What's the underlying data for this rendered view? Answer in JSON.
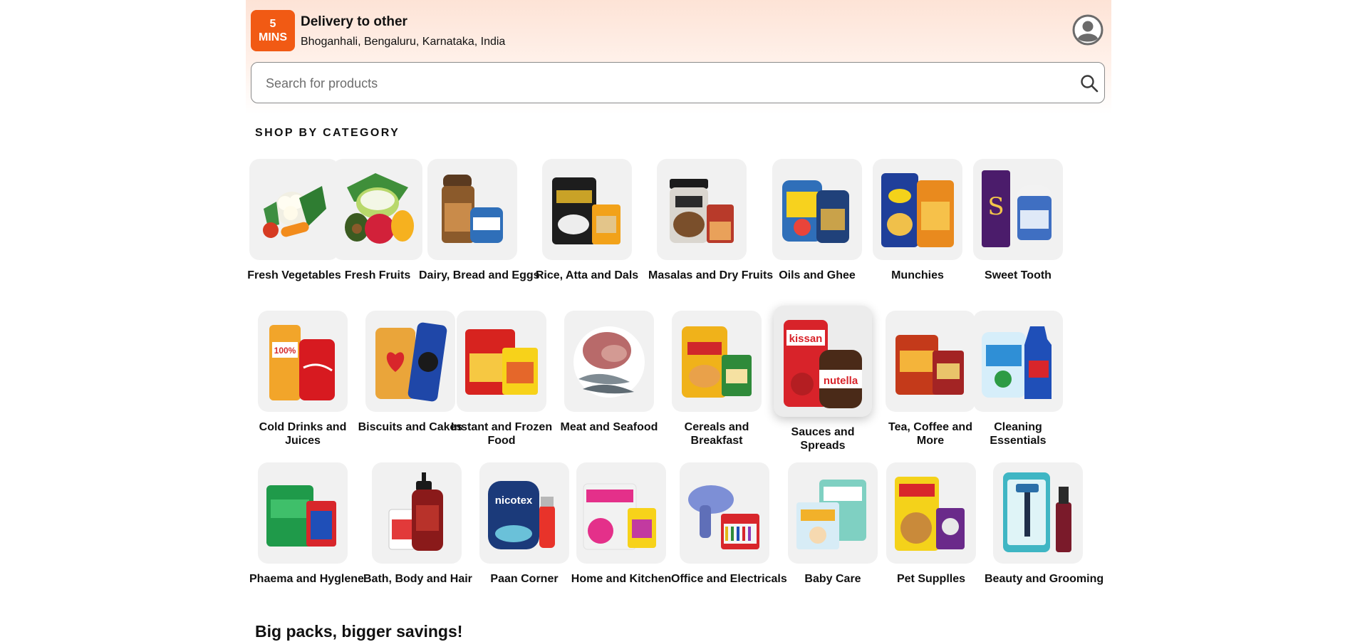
{
  "header": {
    "eta_value": "5",
    "eta_unit": "MINS",
    "delivery_title": "Delivery to other",
    "delivery_address": "Bhoganhali, Bengaluru, Karnataka, India"
  },
  "search": {
    "placeholder": "Search for products",
    "value": ""
  },
  "categories_section": {
    "title": "SHOP BY CATEGORY",
    "rows": [
      [
        {
          "label": "Fresh Vegetables",
          "icon": "vegetables-icon"
        },
        {
          "label": "Fresh Fruits",
          "icon": "fruits-icon"
        },
        {
          "label": "Dairy, Bread and Eggs",
          "icon": "dairy-icon"
        },
        {
          "label": "Rice, Atta and Dals",
          "icon": "rice-icon"
        },
        {
          "label": "Masalas and Dry Fruits",
          "icon": "masala-icon"
        },
        {
          "label": "Oils and Ghee",
          "icon": "oil-icon"
        },
        {
          "label": "Munchies",
          "icon": "chips-icon"
        },
        {
          "label": "Sweet Tooth",
          "icon": "chocolate-icon"
        }
      ],
      [
        {
          "label": "Cold Drinks and Juices",
          "icon": "drinks-icon"
        },
        {
          "label": "Biscuits and Cakes",
          "icon": "biscuits-icon"
        },
        {
          "label": "Instant and Frozen Food",
          "icon": "frozen-food-icon"
        },
        {
          "label": "Meat and Seafood",
          "icon": "meat-icon"
        },
        {
          "label": "Cereals and Breakfast",
          "icon": "cereal-icon"
        },
        {
          "label": "Sauces and Spreads",
          "icon": "sauces-icon"
        },
        {
          "label": "Tea, Coffee and More",
          "icon": "tea-icon"
        },
        {
          "label": "Cleaning Essentials",
          "icon": "cleaning-icon"
        }
      ],
      [
        {
          "label": "Phaema and Hyglene",
          "icon": "pharma-icon"
        },
        {
          "label": "Bath, Body and Hair",
          "icon": "shampoo-icon"
        },
        {
          "label": "Paan Corner",
          "icon": "paan-icon"
        },
        {
          "label": "Home and Kitchen",
          "icon": "kitchen-icon"
        },
        {
          "label": "Office and Electricals",
          "icon": "electricals-icon"
        },
        {
          "label": "Baby Care",
          "icon": "baby-care-icon"
        },
        {
          "label": "Pet Supplles",
          "icon": "pet-food-icon"
        },
        {
          "label": "Beauty and Grooming",
          "icon": "grooming-icon"
        }
      ]
    ]
  },
  "promo": {
    "title": "Big packs, bigger savings!"
  },
  "colors": {
    "brand": "#f15a14",
    "hero_gradient_top": "#fde3d6",
    "tile_bg": "#f1f1f1"
  }
}
